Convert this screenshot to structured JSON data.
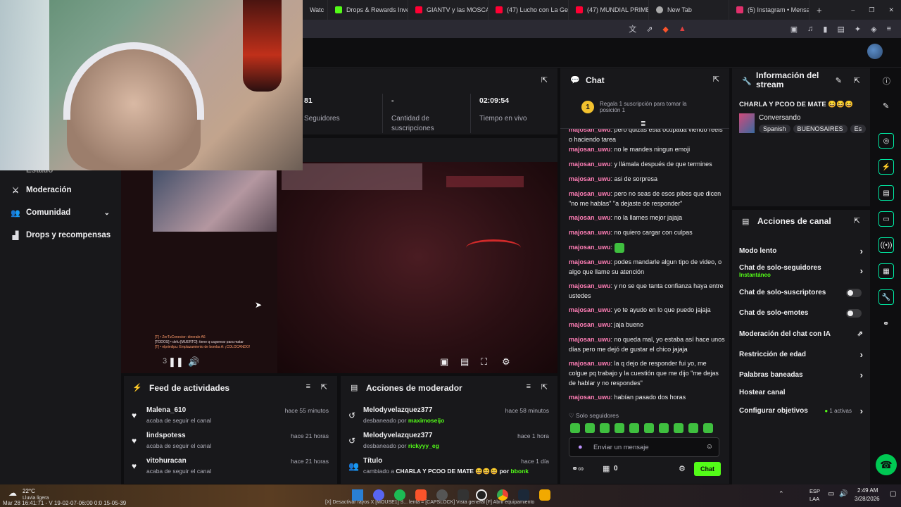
{
  "browser": {
    "tabs": [
      {
        "label": "Watc",
        "color": "#7a7a7a"
      },
      {
        "label": "Drops & Rewards Inve",
        "color": "#53fc18"
      },
      {
        "label": "GIANTV y las MOSCAS",
        "color": "#ff0033"
      },
      {
        "label": "(47) Lucho con La Gen",
        "color": "#ff0033"
      },
      {
        "label": "(47) MUNDIAL PRIME",
        "color": "#ff0033"
      },
      {
        "label": "New Tab",
        "color": "#aaaaaa"
      },
      {
        "label": "(5) Instagram • Mensa",
        "color": "#e1306c"
      }
    ],
    "new_tab": "+",
    "win_min": "–",
    "win_max": "❐",
    "win_close": "✕"
  },
  "stats": {
    "followers_value": "81",
    "followers_label": "Seguidores",
    "subs_value": "-",
    "subs_label": "Cantidad de suscripciones",
    "uptime_value": "02:09:54",
    "uptime_label": "Tiempo en vivo"
  },
  "leftnav": {
    "partial": "Estado",
    "moderation": "Moderación",
    "community": "Comunidad",
    "drops": "Drops y recompensas"
  },
  "video": {
    "time": "3",
    "killfeed_1": "[T] • ZerTuConector: dinerale A6",
    "killfeed_2": "[TODOS] • defu [MUERTO]: tiene q cagonear para matar",
    "killfeed_3": "[T] • elprimilpu: Emplazamiento de bomba A: ¡COLOCANDO!"
  },
  "feed": {
    "title": "Feed de actividades",
    "items": [
      {
        "name": "Malena_610",
        "sub": "acaba de seguir el canal",
        "time": "hace 55 minutos"
      },
      {
        "name": "lindspotess",
        "sub": "acaba de seguir el canal",
        "time": "hace 21 horas"
      },
      {
        "name": "vitohuracan",
        "sub": "acaba de seguir el canal",
        "time": "hace 21 horas"
      }
    ]
  },
  "modactions": {
    "title": "Acciones de moderador",
    "items": [
      {
        "name": "Melodyvelazquez377",
        "pre": "desbaneado por ",
        "by": "maximoseijo",
        "time": "hace 58 minutos"
      },
      {
        "name": "Melodyvelazquez377",
        "pre": "desbaneado por ",
        "by": "rickyyy_eg",
        "time": "hace 1 hora"
      },
      {
        "name": "Título",
        "pre": "cambiado a ",
        "mid": "CHARLA Y PCOO DE MATE 😆😆😆 por ",
        "by": "bbonk",
        "time": "hace 1 día"
      }
    ]
  },
  "chat": {
    "title": "Chat",
    "gift_badge": "1",
    "gift_text": "Regala 1 suscripción para tomar la posición 1",
    "messages": [
      {
        "user": "majosan_uwu",
        "text": "pero quizás está ocupada viendo reels o haciendo tarea"
      },
      {
        "user": "majosan_uwu",
        "text": "no le mandes ningun emoji"
      },
      {
        "user": "majosan_uwu",
        "text": "y llámala después de que termines"
      },
      {
        "user": "majosan_uwu",
        "text": "asi de sorpresa"
      },
      {
        "user": "majosan_uwu",
        "text": "pero no seas de esos pibes que dicen \"no me hablas\" \"a dejaste de responder\""
      },
      {
        "user": "majosan_uwu",
        "text": "no la llames mejor jajaja"
      },
      {
        "user": "majosan_uwu",
        "text": "no quiero cargar con culpas"
      },
      {
        "user": "majosan_uwu",
        "text": ""
      },
      {
        "user": "majosan_uwu",
        "text": "podes mandarle algun tipo de video, o algo que llame su atención"
      },
      {
        "user": "majosan_uwu",
        "text": "y no se que tanta confianza haya entre ustedes"
      },
      {
        "user": "majosan_uwu",
        "text": "yo te ayudo en lo que puedo jajaja"
      },
      {
        "user": "majosan_uwu",
        "text": "jaja bueno"
      },
      {
        "user": "majosan_uwu",
        "text": "no queda mal, yo estaba así hace unos días pero me dejó de gustar el chico jajaja"
      },
      {
        "user": "majosan_uwu",
        "text": "la q dejo de responder fui yo, me colgue pq trabajo y la cuestión que me dijo \"me dejas de hablar y no respondes\""
      },
      {
        "user": "majosan_uwu",
        "text": "habían pasado dos horas"
      }
    ],
    "followers_only": "Solo seguidores",
    "input_placeholder": "Enviar un mensaje",
    "points": "0",
    "send_label": "Chat"
  },
  "info": {
    "title": "Información del stream",
    "stream_title": "CHARLA Y PCOO DE MATE 😆😆😆",
    "category": "Conversando",
    "tags": [
      "Spanish",
      "BUENOSAIRES",
      "Es"
    ]
  },
  "actions": {
    "title": "Acciones de canal",
    "slow": "Modo lento",
    "followers_chat": "Chat de solo-seguidores",
    "followers_chat_sub": "Instantáneo",
    "subs_chat": "Chat de solo-suscriptores",
    "emotes_chat": "Chat de solo-emotes",
    "ai_mod": "Moderación del chat con IA",
    "age": "Restricción de edad",
    "banned_words": "Palabras baneadas",
    "host": "Hostear canal",
    "goals": "Configurar objetivos",
    "goals_active": "1 activas"
  },
  "taskbar": {
    "weather_temp": "22°C",
    "weather_desc": "Lluvia ligera",
    "lang_1": "ESP",
    "lang_2": "LAA",
    "time": "2:49 AM",
    "date": "3/28/2026",
    "overlay_text": "Mar 28 16:41:71 - V 19-02-07-06:00 0:0 15-05-39",
    "overlay_hint": "[X] Desactivar rayos X    [MOUSE1] S... lenta  = [CAPSLOCK] Vista general   [F] Abrir equipamiento"
  },
  "colors": {
    "accent": "#53fc18",
    "username": "#ff7eb6",
    "mod_link": "#53fc18",
    "bg": "#18181b"
  }
}
